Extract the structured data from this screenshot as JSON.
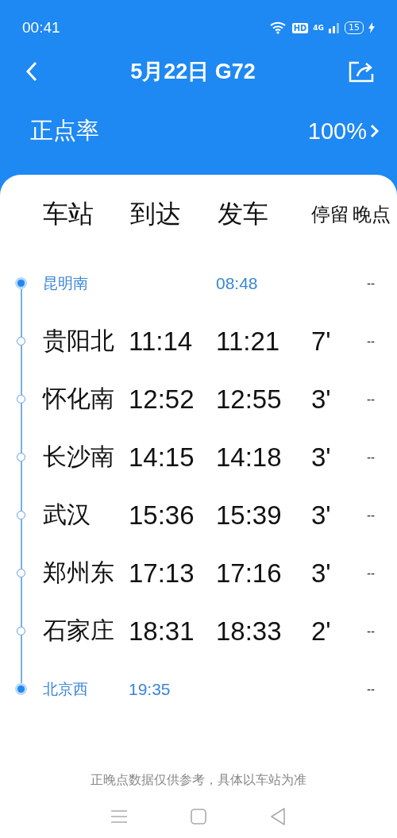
{
  "status_bar": {
    "time": "00:41",
    "hd": "HD",
    "network": "4G",
    "battery": "15"
  },
  "nav": {
    "title": "5月22日 G72"
  },
  "punctuality": {
    "label": "正点率",
    "value": "100%"
  },
  "table": {
    "columns": [
      "车站",
      "到达",
      "发车",
      "停留",
      "晚点"
    ],
    "rows": [
      {
        "kind": "terminal",
        "station": "昆明南",
        "arrive": "",
        "depart": "08:48",
        "stay": "",
        "late": "--"
      },
      {
        "kind": "stop",
        "station": "贵阳北",
        "arrive": "11:14",
        "depart": "11:21",
        "stay": "7'",
        "late": "--"
      },
      {
        "kind": "stop",
        "station": "怀化南",
        "arrive": "12:52",
        "depart": "12:55",
        "stay": "3'",
        "late": "--"
      },
      {
        "kind": "stop",
        "station": "长沙南",
        "arrive": "14:15",
        "depart": "14:18",
        "stay": "3'",
        "late": "--"
      },
      {
        "kind": "stop",
        "station": "武汉",
        "arrive": "15:36",
        "depart": "15:39",
        "stay": "3'",
        "late": "--"
      },
      {
        "kind": "stop",
        "station": "郑州东",
        "arrive": "17:13",
        "depart": "17:16",
        "stay": "3'",
        "late": "--"
      },
      {
        "kind": "stop",
        "station": "石家庄",
        "arrive": "18:31",
        "depart": "18:33",
        "stay": "2'",
        "late": "--"
      },
      {
        "kind": "terminal",
        "station": "北京西",
        "arrive": "19:35",
        "depart": "",
        "stay": "",
        "late": "--"
      }
    ]
  },
  "note": "正晚点数据仅供参考，具体以车站为准"
}
